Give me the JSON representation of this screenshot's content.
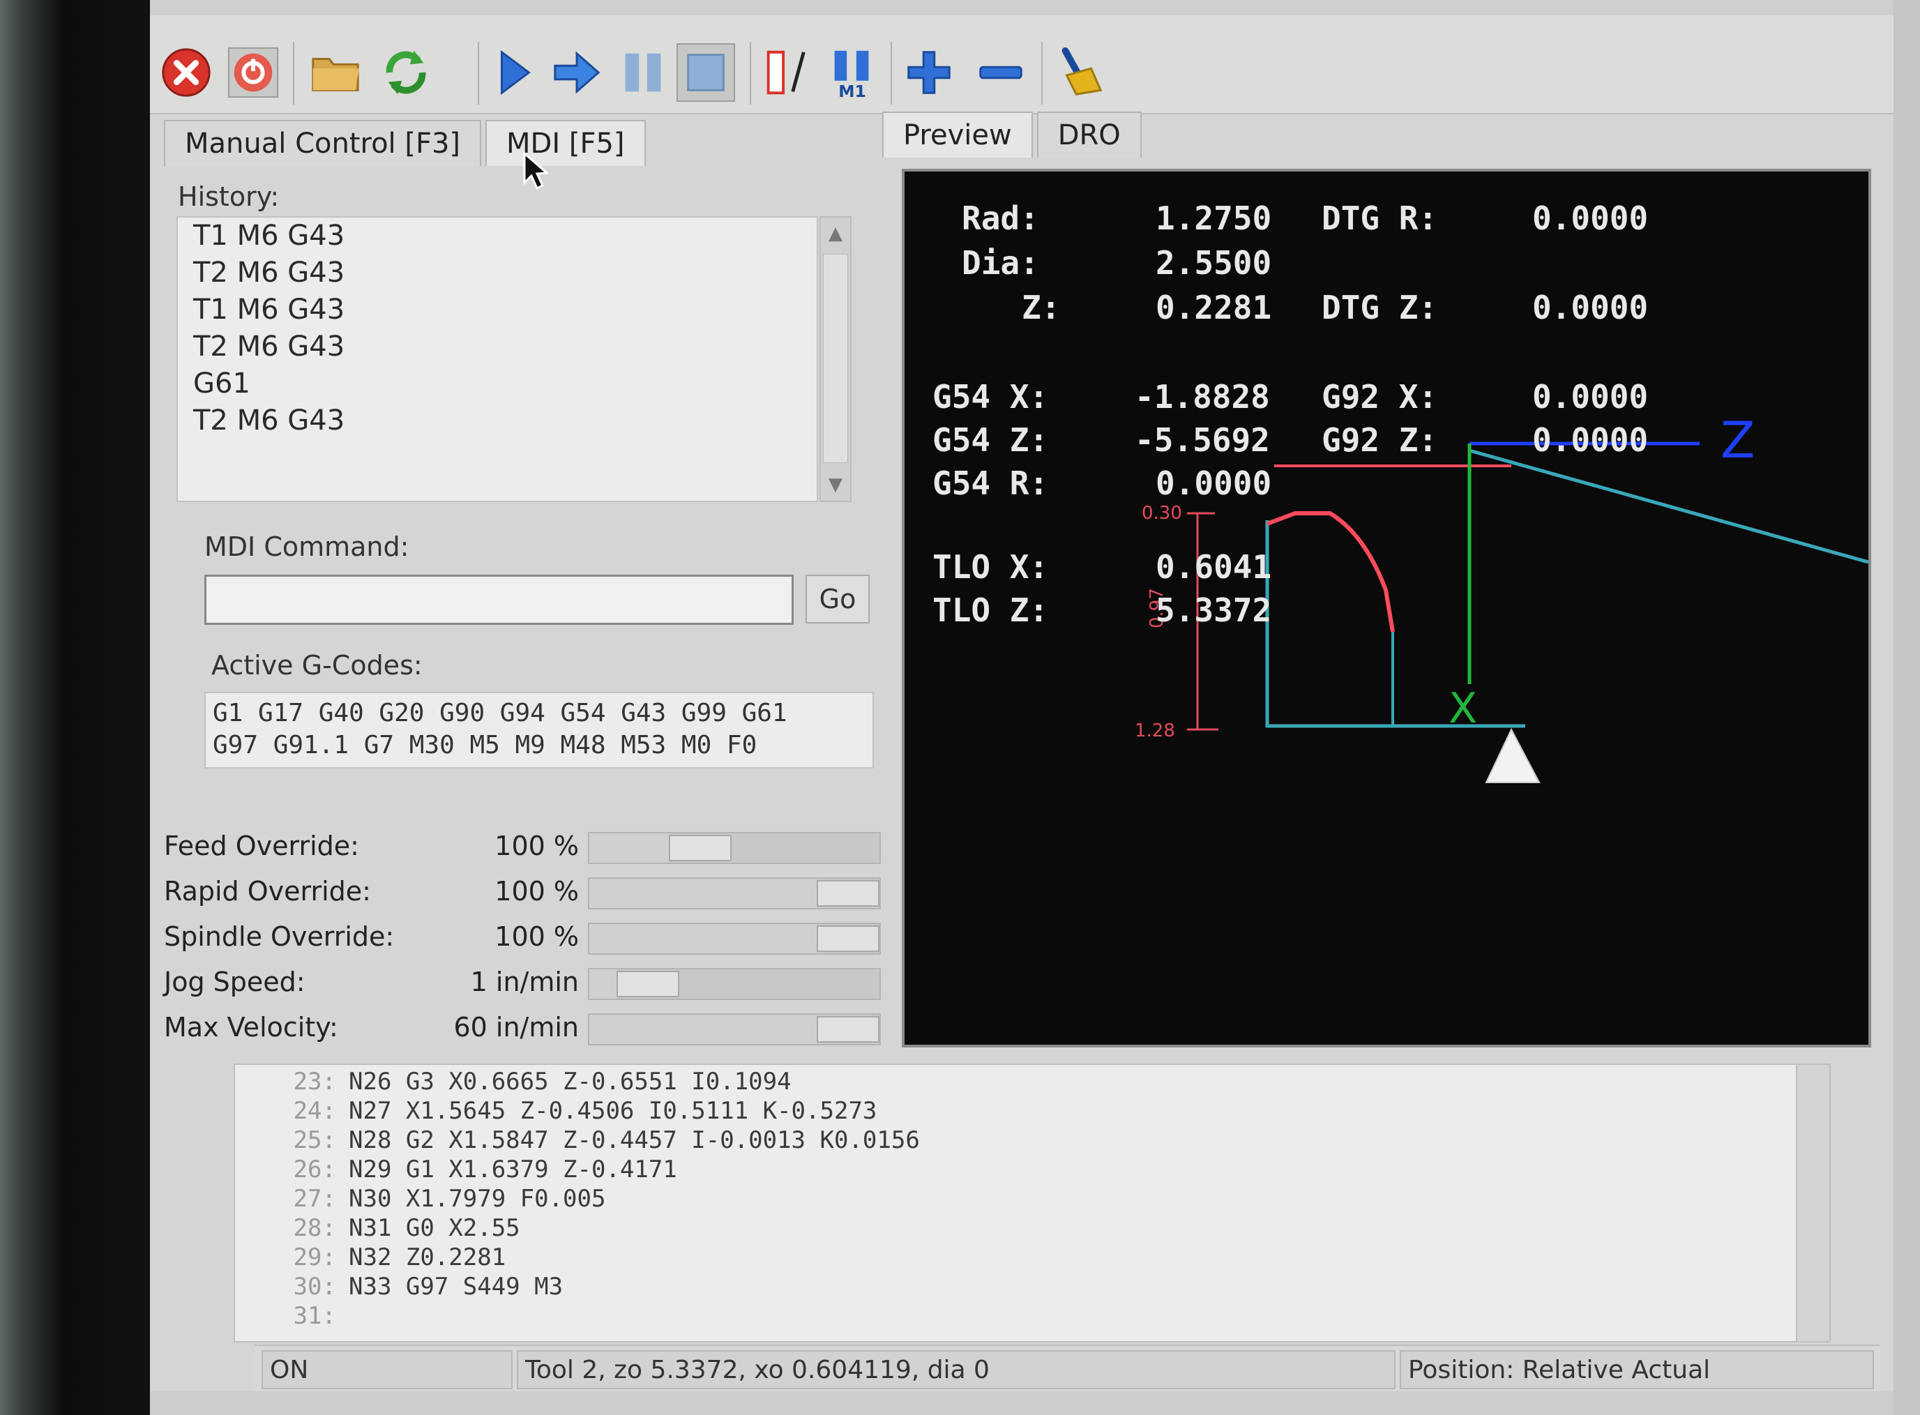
{
  "toolbar": {
    "buttons": [
      {
        "name": "estop-icon"
      },
      {
        "name": "machine-power-icon"
      },
      {
        "name": "open-file-icon"
      },
      {
        "name": "reload-icon"
      },
      {
        "name": "run-icon"
      },
      {
        "name": "step-icon"
      },
      {
        "name": "pause-icon"
      },
      {
        "name": "stop-icon"
      },
      {
        "name": "block-delete-icon"
      },
      {
        "name": "optional-stop-icon"
      },
      {
        "name": "zoom-in-icon"
      },
      {
        "name": "zoom-out-icon"
      },
      {
        "name": "clear-plot-icon"
      }
    ],
    "optional_stop_label": "M1"
  },
  "left_tabs": {
    "manual": "Manual Control [F3]",
    "mdi": "MDI [F5]"
  },
  "right_tabs": {
    "preview": "Preview",
    "dro": "DRO"
  },
  "mdi": {
    "history_label": "History:",
    "history": [
      "T1 M6 G43",
      "T2 M6 G43",
      "T1 M6 G43",
      "T2 M6 G43",
      "G61",
      "T2 M6 G43"
    ],
    "command_label": "MDI Command:",
    "command_value": "",
    "go_label": "Go",
    "active_gcodes_label": "Active G-Codes:",
    "active_gcodes_line1": "G1 G17 G40 G20 G90 G94 G54 G43 G99 G61",
    "active_gcodes_line2": "G97 G91.1 G7 M30 M5 M9 M48 M53 M0 F0"
  },
  "overrides": [
    {
      "name": "Feed Override:",
      "value": "100 %",
      "level": 0.35
    },
    {
      "name": "Rapid Override:",
      "value": "100 %",
      "level": 1.0
    },
    {
      "name": "Spindle Override:",
      "value": "100 %",
      "level": 1.0
    },
    {
      "name": "Jog Speed:",
      "value": "1 in/min",
      "level": 0.12
    },
    {
      "name": "Max Velocity:",
      "value": "60 in/min",
      "level": 1.0
    }
  ],
  "dro": {
    "rad_label": "Rad:",
    "rad": "1.2750",
    "dtg_r_label": "DTG R:",
    "dtg_r": "0.0000",
    "dia_label": "Dia:",
    "dia": "2.5500",
    "z_label": "Z:",
    "z": "0.2281",
    "dtg_z_label": "DTG Z:",
    "dtg_z": "0.0000",
    "g54x_label": "G54 X:",
    "g54x": "-1.8828",
    "g92x_label": "G92 X:",
    "g92x": "0.0000",
    "g54z_label": "G54 Z:",
    "g54z": "-5.5692",
    "g92z_label": "G92 Z:",
    "g92z": "0.0000",
    "g54r_label": "G54 R:",
    "g54r": "0.0000",
    "tlox_label": "TLO X:",
    "tlox": "0.6041",
    "tloz_label": "TLO Z:",
    "tloz": "5.3372"
  },
  "preview_labels": {
    "axis_z": "Z",
    "axis_x": "X",
    "dim_top": "0.30",
    "dim_bottom": "1.28",
    "dim_side": "0.97"
  },
  "program": [
    {
      "num": "23:",
      "text": "N26 G3 X0.6665 Z-0.6551 I0.1094"
    },
    {
      "num": "24:",
      "text": "N27 X1.5645 Z-0.4506 I0.5111 K-0.5273"
    },
    {
      "num": "25:",
      "text": "N28 G2 X1.5847 Z-0.4457 I-0.0013 K0.0156"
    },
    {
      "num": "26:",
      "text": "N29 G1 X1.6379 Z-0.4171"
    },
    {
      "num": "27:",
      "text": "N30 X1.7979 F0.005"
    },
    {
      "num": "28:",
      "text": "N31 G0 X2.55"
    },
    {
      "num": "29:",
      "text": "N32 Z0.2281"
    },
    {
      "num": "30:",
      "text": "N33 G97 S449 M3"
    },
    {
      "num": "31:",
      "text": ""
    }
  ],
  "status": {
    "state": "ON",
    "tool": "Tool 2, zo 5.3372, xo 0.604119, dia 0",
    "position": "Position: Relative Actual"
  },
  "colors": {
    "estop": "#d9332b",
    "run": "#2f6fd6",
    "toolpath": "#ff4b5c",
    "feed": "#3aa7b8",
    "axis_x": "#22b83a",
    "axis_z": "#1f3fff",
    "dims": "#e34b5b"
  }
}
